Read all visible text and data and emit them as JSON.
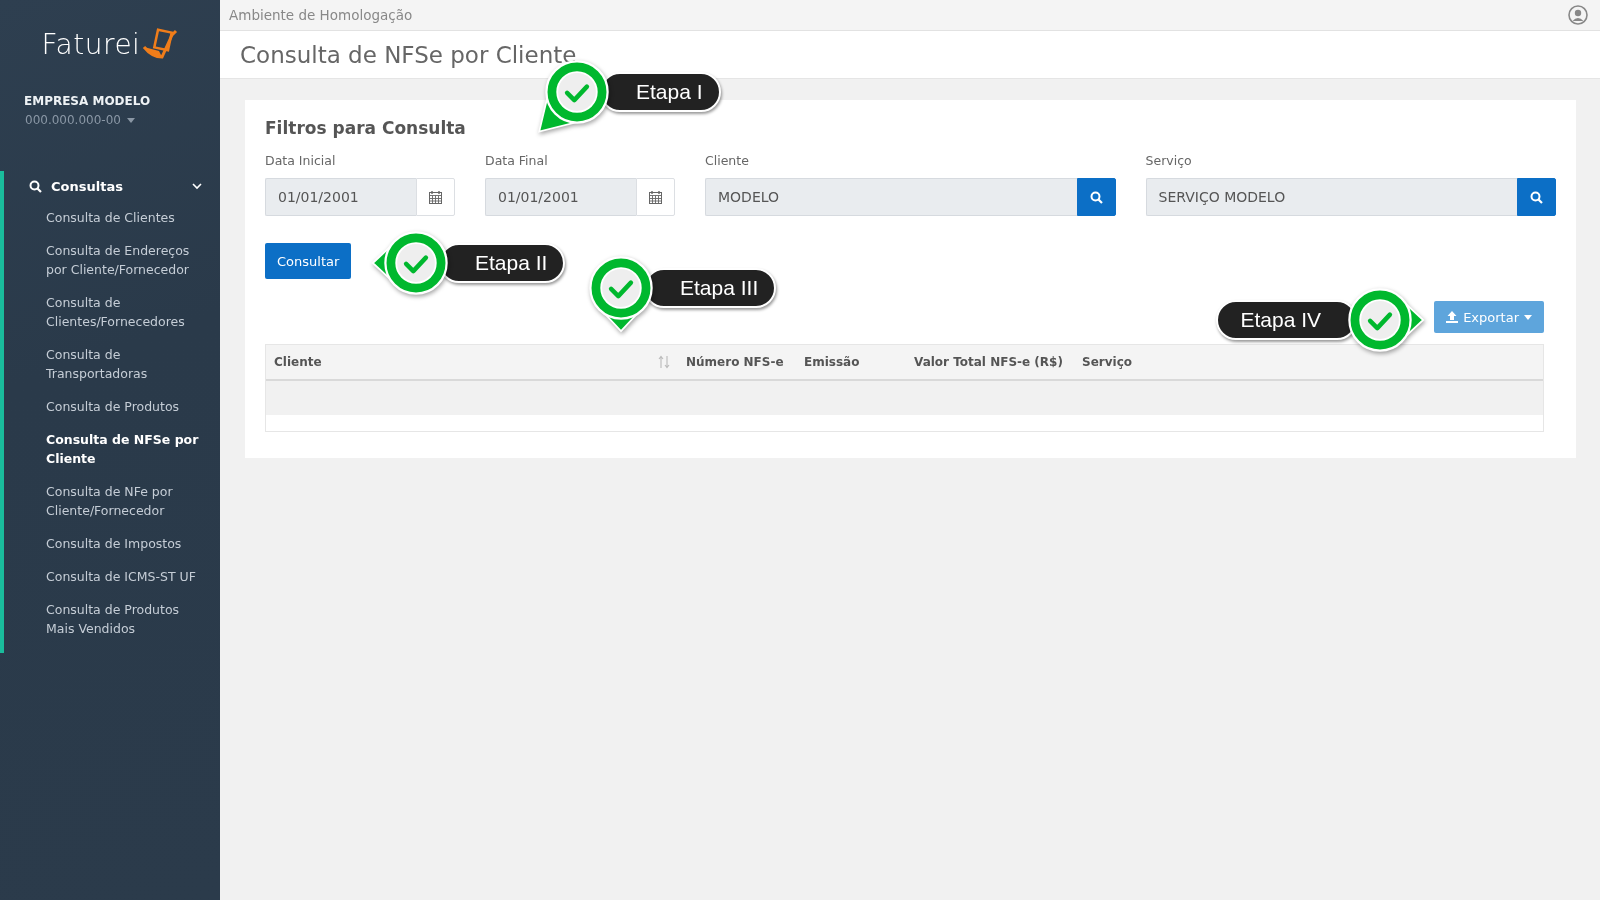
{
  "sidebar": {
    "logo": "Faturei",
    "company": "EMPRESA MODELO",
    "document": "000.000.000-00",
    "menu": [
      {
        "label": "Consultas",
        "expanded": true,
        "children": [
          {
            "label": "Consulta de Clientes",
            "selected": false
          },
          {
            "label": "Consulta de Endereços por Cliente/Fornecedor",
            "selected": false
          },
          {
            "label": "Consulta de Clientes/Fornecedores",
            "selected": false
          },
          {
            "label": "Consulta de Transportadoras",
            "selected": false
          },
          {
            "label": "Consulta de Produtos",
            "selected": false
          },
          {
            "label": "Consulta de NFSe por Cliente",
            "selected": true
          },
          {
            "label": "Consulta de NFe por Cliente/Fornecedor",
            "selected": false
          },
          {
            "label": "Consulta de Impostos",
            "selected": false
          },
          {
            "label": "Consulta de ICMS-ST UF",
            "selected": false
          },
          {
            "label": "Consulta de Produtos Mais Vendidos",
            "selected": false
          }
        ]
      }
    ]
  },
  "top_bar": {
    "environment": "Ambiente de Homologação"
  },
  "page_title": "Consulta de NFSe por Cliente",
  "filters": {
    "title": "Filtros para Consulta",
    "fields": [
      {
        "label": "Data Inicial",
        "value": "01/01/2001",
        "kind": "date"
      },
      {
        "label": "Data Final",
        "value": "01/01/2001",
        "kind": "date"
      },
      {
        "label": "Cliente",
        "value": "MODELO",
        "kind": "search"
      },
      {
        "label": "Serviço",
        "value": "SERVIÇO MODELO",
        "kind": "search"
      }
    ],
    "submit": "Consultar"
  },
  "export_button": "Exportar",
  "table": {
    "columns": [
      {
        "label": "Cliente",
        "sortable": true
      },
      {
        "label": "Número NFS-e",
        "sortable": false
      },
      {
        "label": "Emissão",
        "sortable": false
      },
      {
        "label": "Valor Total NFS-e (R$)",
        "sortable": false
      },
      {
        "label": "Serviço",
        "sortable": false
      }
    ]
  },
  "callouts": [
    {
      "label": "Etapa I",
      "kind": "down-left"
    },
    {
      "label": "Etapa II",
      "kind": "left"
    },
    {
      "label": "Etapa III",
      "kind": "down"
    },
    {
      "label": "Etapa IV",
      "kind": "right"
    }
  ]
}
